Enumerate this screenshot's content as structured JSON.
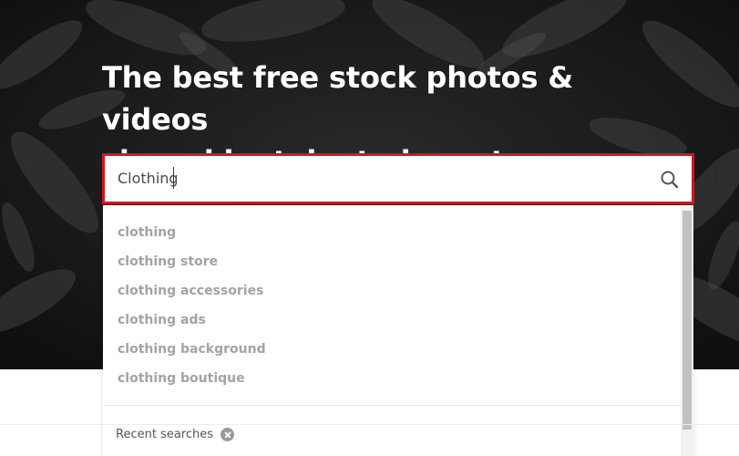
{
  "hero": {
    "headline_line1": "The best free stock photos & videos",
    "headline_line2": "shared by talented creators."
  },
  "search": {
    "value": "Clothing",
    "icon": "search-icon",
    "border_color": "#d8141c"
  },
  "dropdown": {
    "suggestions": [
      "clothing",
      "clothing store",
      "clothing accessories",
      "clothing ads",
      "clothing background",
      "clothing boutique"
    ],
    "recent_label": "Recent searches",
    "clear_icon": "clear-circle-icon"
  }
}
